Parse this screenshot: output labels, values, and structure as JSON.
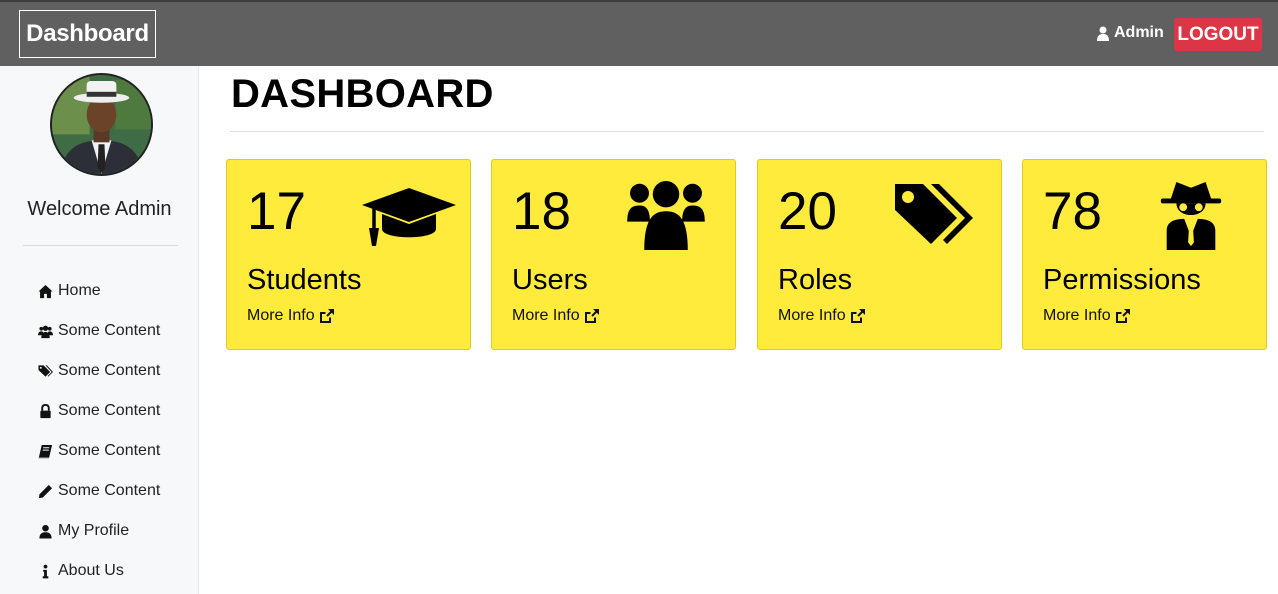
{
  "navbar": {
    "brand": "Dashboard",
    "user_name": "Admin",
    "user_icon": "user-icon",
    "logout_label": "LOGOUT"
  },
  "sidebar": {
    "welcome_text": "Welcome Admin",
    "items": [
      {
        "label": "Home",
        "icon": "home-icon"
      },
      {
        "label": "Some Content",
        "icon": "users-icon"
      },
      {
        "label": "Some Content",
        "icon": "tags-icon"
      },
      {
        "label": "Some Content",
        "icon": "lock-icon"
      },
      {
        "label": "Some Content",
        "icon": "book-icon"
      },
      {
        "label": "Some Content",
        "icon": "pencil-icon"
      },
      {
        "label": "My Profile",
        "icon": "user-icon"
      },
      {
        "label": "About Us",
        "icon": "info-icon"
      }
    ]
  },
  "main": {
    "title": "DASHBOARD",
    "cards": [
      {
        "count": "17",
        "label": "Students",
        "link": "More Info",
        "icon": "graduation-cap-icon"
      },
      {
        "count": "18",
        "label": "Users",
        "link": "More Info",
        "icon": "users-icon"
      },
      {
        "count": "20",
        "label": "Roles",
        "link": "More Info",
        "icon": "tags-icon"
      },
      {
        "count": "78",
        "label": "Permissions",
        "link": "More Info",
        "icon": "user-secret-icon"
      }
    ]
  },
  "colors": {
    "navbar_bg": "#606060",
    "logout_bg": "#dc3545",
    "card_bg": "#ffeb3b",
    "sidebar_bg": "#f7f8fa"
  }
}
